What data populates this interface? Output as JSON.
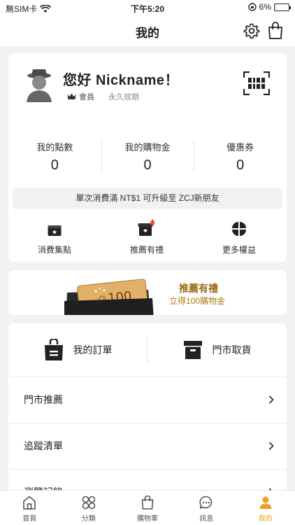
{
  "status_bar": {
    "carrier": "無SIM卡",
    "time": "下午5:20",
    "battery": "6%",
    "battery_level": 0.06
  },
  "header": {
    "title": "我的"
  },
  "profile": {
    "greeting": "您好 Nickname！",
    "member_label": "會員",
    "validity": "永久效期"
  },
  "stats": [
    {
      "label": "我的點數",
      "value": "0"
    },
    {
      "label": "我的購物金",
      "value": "0"
    },
    {
      "label": "優惠券",
      "value": "0"
    }
  ],
  "upgrade_notice": "單次消費滿 NT$1 可升級至 ZCJ新朋友",
  "quick_links": [
    {
      "label": "消費集點",
      "icon": "point-card-icon"
    },
    {
      "label": "推薦有禮",
      "icon": "gift-icon"
    },
    {
      "label": "更多權益",
      "icon": "more-benefits-icon"
    }
  ],
  "banner": {
    "title": "推薦有禮",
    "subtitle": "立得100購物金",
    "ticket_value": "100"
  },
  "orders": {
    "my_orders": "我的訂單",
    "store_pickup": "門市取貨"
  },
  "menu": [
    "門市推薦",
    "追蹤清單",
    "瀏覽記錄"
  ],
  "tabs": [
    {
      "label": "首頁",
      "icon": "home-icon",
      "active": false
    },
    {
      "label": "分類",
      "icon": "category-icon",
      "active": false
    },
    {
      "label": "購物車",
      "icon": "cart-icon",
      "active": false
    },
    {
      "label": "訊息",
      "icon": "message-icon",
      "active": false
    },
    {
      "label": "我的",
      "icon": "profile-icon",
      "active": true
    }
  ],
  "colors": {
    "accent": "#f0a020",
    "banner_text": "#9a6a12",
    "badge": "#ff4a2a"
  }
}
